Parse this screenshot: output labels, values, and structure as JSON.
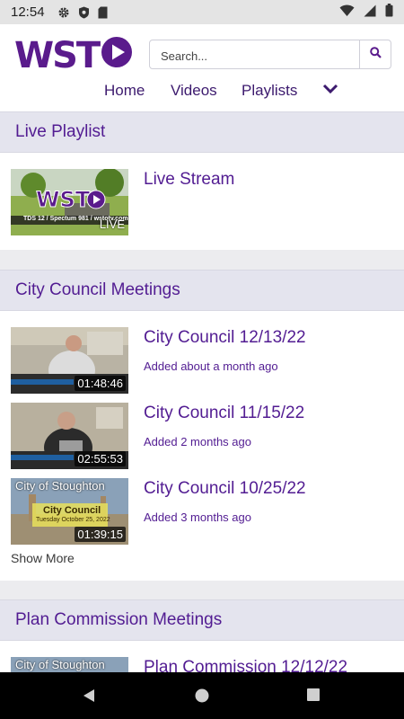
{
  "status_bar": {
    "time": "12:54",
    "left_icons": [
      "gear-icon",
      "shield-icon",
      "sd-card-icon"
    ],
    "right_icons": [
      "wifi-icon",
      "cellular-signal-icon",
      "battery-icon"
    ]
  },
  "header": {
    "logo_text": "WST",
    "search": {
      "placeholder": "Search...",
      "value": ""
    },
    "nav": [
      "Home",
      "Videos",
      "Playlists"
    ],
    "colors": {
      "brand": "#5a1b8c",
      "link": "#521c92",
      "section_bg": "#e4e4ee"
    }
  },
  "sections": [
    {
      "title": "Live Playlist",
      "items": [
        {
          "title": "Live Stream",
          "badge": "LIVE",
          "thumb_caption": "TDS 12 / Spectum 981 / wstotv.com"
        }
      ]
    },
    {
      "title": "City Council Meetings",
      "items": [
        {
          "title": "City Council 12/13/22",
          "added": "Added about a month ago",
          "duration": "01:48:46"
        },
        {
          "title": "City Council 11/15/22",
          "added": "Added 2 months ago",
          "duration": "02:55:53"
        },
        {
          "title": "City Council 10/25/22",
          "added": "Added 3 months ago",
          "duration": "01:39:15",
          "thumb_heading": "City of Stoughton",
          "thumb_sub": "City Council",
          "thumb_date": "Tuesday October 25, 2022"
        }
      ],
      "show_more": "Show More"
    },
    {
      "title": "Plan Commission Meetings",
      "items": [
        {
          "title": "Plan Commission 12/12/22",
          "thumb_heading": "City of Stoughton"
        }
      ]
    }
  ],
  "android_nav": [
    "back-icon",
    "home-icon",
    "recents-icon"
  ]
}
